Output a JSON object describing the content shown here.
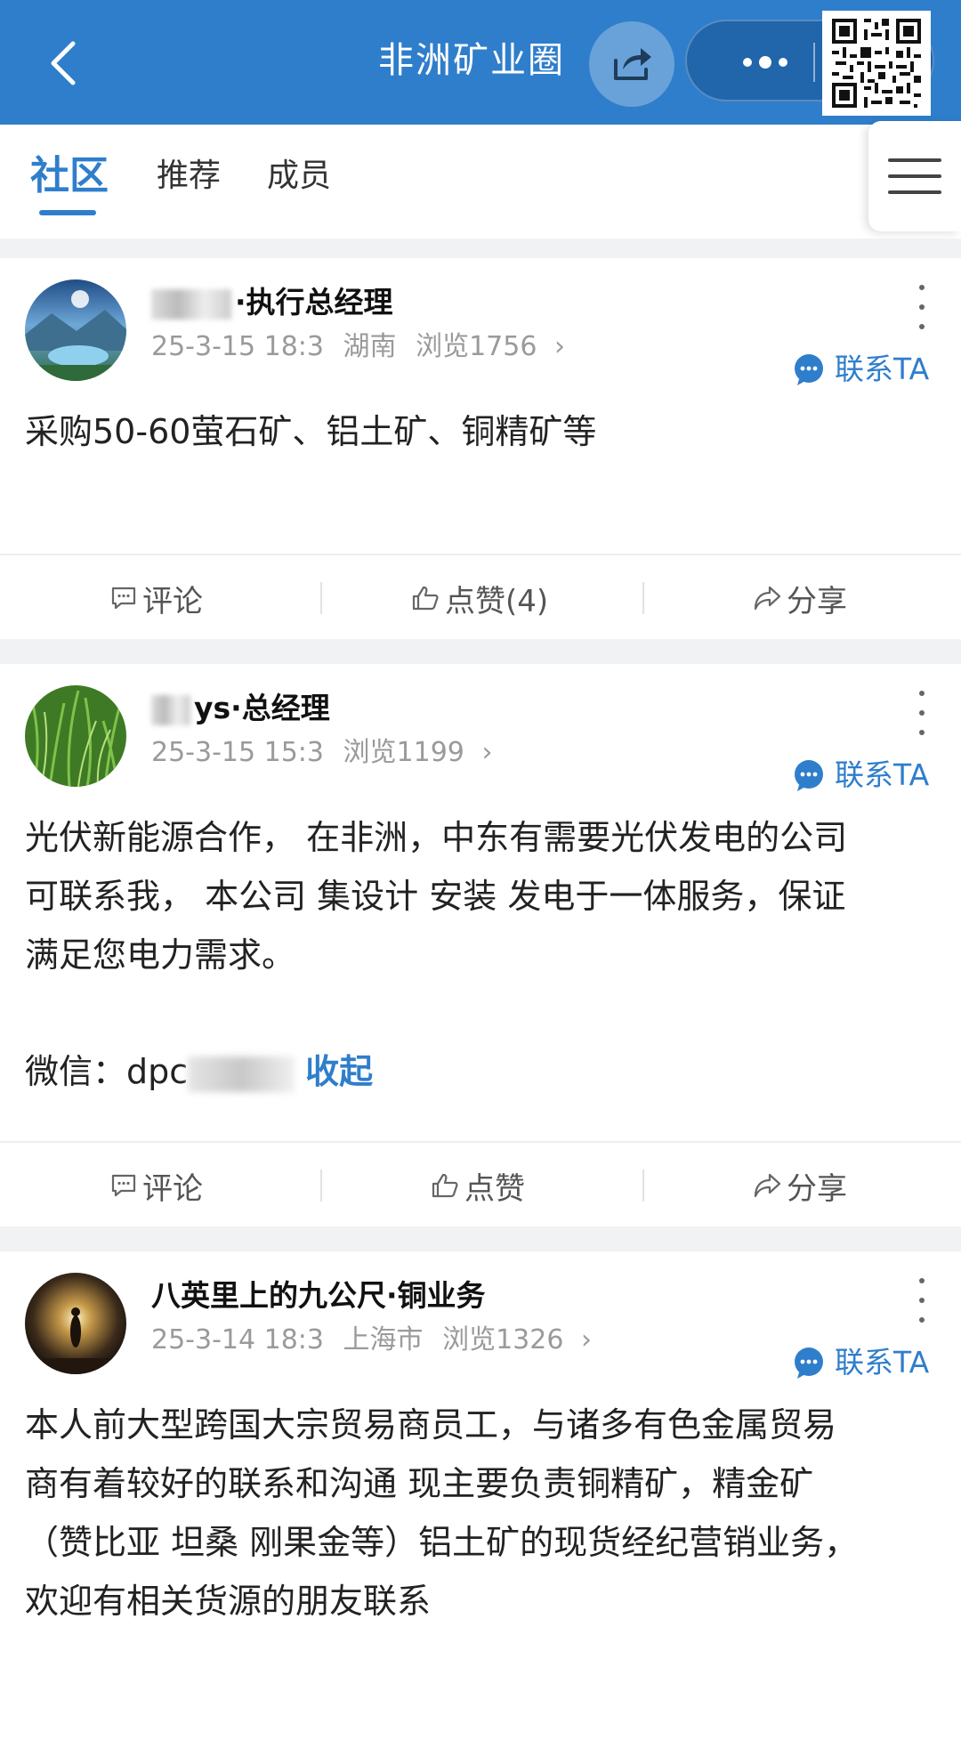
{
  "header": {
    "title": "非洲矿业圈",
    "back_icon": "back-arrow-icon",
    "share_icon": "share-icon",
    "more_icon": "more-dots-icon",
    "qr_icon": "qr-code-icon"
  },
  "tabs": [
    {
      "label": "社区",
      "active": true
    },
    {
      "label": "推荐",
      "active": false
    },
    {
      "label": "成员",
      "active": false
    }
  ],
  "posts": [
    {
      "author": "·执行总经理",
      "author_prefix_redacted": true,
      "date": "25-3-15 18:3",
      "location": "湖南",
      "views": "浏览1756",
      "contact_label": "联系TA",
      "content": "采购50-60萤石矿、铝土矿、铜精矿等",
      "comment_label": "评论",
      "like_label": "点赞(4)",
      "share_label": "分享"
    },
    {
      "author_visible": "ys·总经理",
      "date": "25-3-15 15:3",
      "location": "",
      "views": "浏览1199",
      "contact_label": "联系TA",
      "content": "光伏新能源合作， 在非洲，中东有需要光伏发电的公司\n可联系我， 本公司 集设计 安装 发电于一体服务，保证\n满足您电力需求。",
      "wechat_prefix": "微信：dpc",
      "collapse_label": "收起",
      "comment_label": "评论",
      "like_label": "点赞",
      "share_label": "分享"
    },
    {
      "author": "八英里上的九公尺·铜业务",
      "date": "25-3-14 18:3",
      "location": "上海市",
      "views": "浏览1326",
      "contact_label": "联系TA",
      "content": "本人前大型跨国大宗贸易商员工，与诸多有色金属贸易\n商有着较好的联系和沟通 现主要负责铜精矿，精金矿\n（赞比亚 坦桑 刚果金等）铝土矿的现货经纪营销业务，\n欢迎有相关货源的朋友联系"
    }
  ],
  "colors": {
    "brand_blue": "#2f7ecb",
    "meta_gray": "#9a9a9a",
    "band_gray": "#f1f2f4"
  }
}
